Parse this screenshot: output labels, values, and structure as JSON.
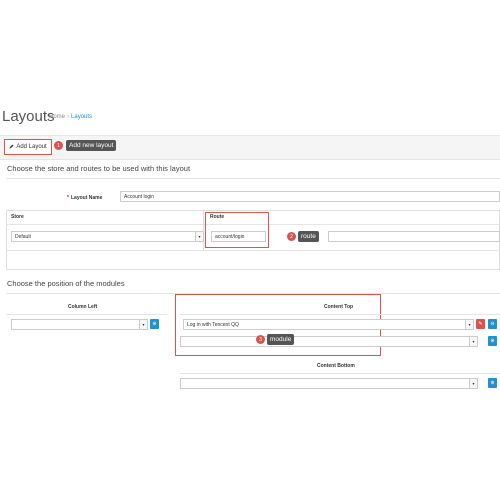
{
  "header": {
    "title": "Layouts",
    "breadcrumb": [
      "Home",
      "Layouts"
    ],
    "breadcrumb_sep": "›"
  },
  "toolbar": {
    "add_label": "Add Layout",
    "add_icon": "pencil-icon"
  },
  "callouts": [
    {
      "num": "1",
      "text": "Add new layout"
    },
    {
      "num": "2",
      "text": "route"
    },
    {
      "num": "3",
      "text": "module"
    }
  ],
  "routes_section": {
    "title": "Choose the store and routes to be used with this layout",
    "layout_name_label": "Layout Name",
    "required_mark": "*",
    "layout_name_value": "Account login",
    "store_header": "Store",
    "route_header": "Route",
    "store_value": "Default",
    "route_value": "account/login"
  },
  "modules_section": {
    "title": "Choose the position of the modules",
    "column_left_label": "Column Left",
    "content_top_label": "Content Top",
    "content_top_module": "Log in with Tencent QQ",
    "content_bottom_label": "Content Bottom"
  },
  "colors": {
    "accent_blue": "#1e91cf",
    "callout_red": "#d9534f",
    "tooltip_dark": "#555555"
  }
}
